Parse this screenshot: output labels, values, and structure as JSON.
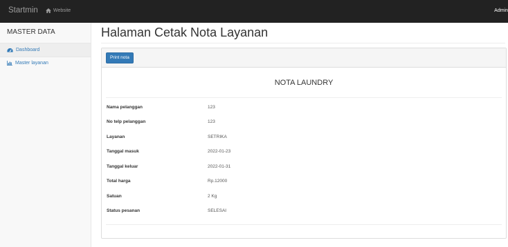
{
  "navbar": {
    "brand": "Startmin",
    "website_label": "Website",
    "admin_label": "Admin"
  },
  "sidebar": {
    "heading": "MASTER DATA",
    "items": [
      {
        "label": "Dashboard",
        "icon": "dashboard-icon",
        "active": true
      },
      {
        "label": "Master layanan",
        "icon": "bar-chart-icon",
        "active": false
      }
    ]
  },
  "main": {
    "page_title": "Halaman Cetak Nota Layanan",
    "print_button_label": "Print nota",
    "nota_title": "NOTA LAUNDRY",
    "rows": [
      {
        "label": "Nama pelanggan",
        "value": "123"
      },
      {
        "label": "No telp pelanggan",
        "value": "123"
      },
      {
        "label": "Layanan",
        "value": "SETRIKA"
      },
      {
        "label": "Tanggal masuk",
        "value": "2022-01-23"
      },
      {
        "label": "Tanggal keluar",
        "value": "2022-01-31"
      },
      {
        "label": "Total harga",
        "value": "Rp.12000"
      },
      {
        "label": "Satuan",
        "value": "2 Kg"
      },
      {
        "label": "Status pesanan",
        "value": "SELESAI"
      }
    ]
  },
  "colors": {
    "navbar_bg": "#222222",
    "link": "#337ab7",
    "button_primary": "#337ab7",
    "sidebar_bg": "#f8f8f8"
  }
}
